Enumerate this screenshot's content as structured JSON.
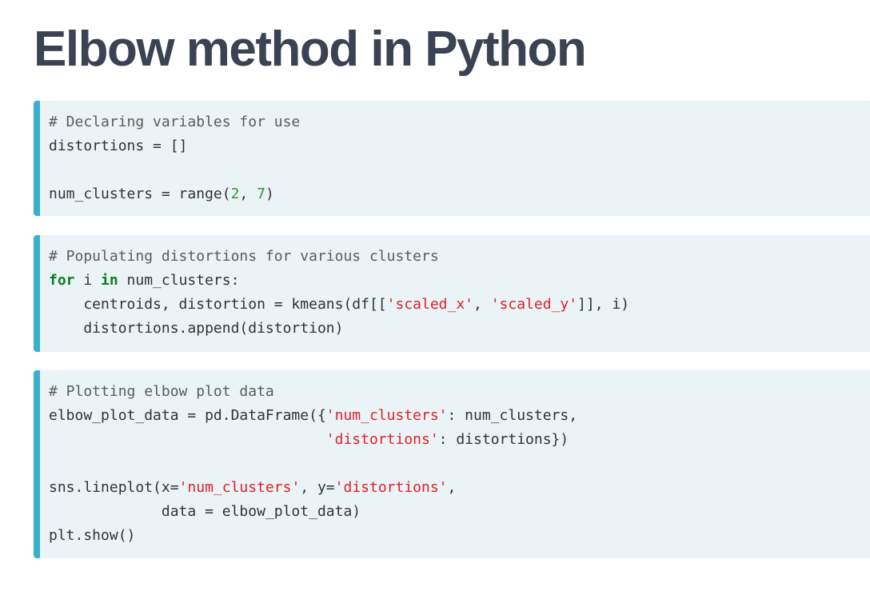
{
  "title": "Elbow method in Python",
  "code_blocks": [
    {
      "lines": [
        [
          {
            "t": "# Declaring variables for use",
            "k": "comment"
          }
        ],
        [
          {
            "t": "distortions = []",
            "k": "plain"
          }
        ],
        [],
        [
          {
            "t": "num_clusters = range(",
            "k": "plain"
          },
          {
            "t": "2",
            "k": "num"
          },
          {
            "t": ", ",
            "k": "plain"
          },
          {
            "t": "7",
            "k": "num"
          },
          {
            "t": ")",
            "k": "plain"
          }
        ]
      ]
    },
    {
      "lines": [
        [
          {
            "t": "# Populating distortions for various clusters",
            "k": "comment"
          }
        ],
        [
          {
            "t": "for",
            "k": "kw"
          },
          {
            "t": " i ",
            "k": "plain"
          },
          {
            "t": "in",
            "k": "kw"
          },
          {
            "t": " num_clusters:",
            "k": "plain"
          }
        ],
        [
          {
            "t": "    centroids, distortion = kmeans(df[[",
            "k": "plain"
          },
          {
            "t": "'scaled_x'",
            "k": "str"
          },
          {
            "t": ", ",
            "k": "plain"
          },
          {
            "t": "'scaled_y'",
            "k": "str"
          },
          {
            "t": "]], i)",
            "k": "plain"
          }
        ],
        [
          {
            "t": "    distortions.append(distortion)",
            "k": "plain"
          }
        ]
      ]
    },
    {
      "lines": [
        [
          {
            "t": "# Plotting elbow plot data",
            "k": "comment"
          }
        ],
        [
          {
            "t": "elbow_plot_data = pd.DataFrame({",
            "k": "plain"
          },
          {
            "t": "'num_clusters'",
            "k": "str"
          },
          {
            "t": ": num_clusters,",
            "k": "plain"
          }
        ],
        [
          {
            "t": "                                ",
            "k": "plain"
          },
          {
            "t": "'distortions'",
            "k": "str"
          },
          {
            "t": ": distortions})",
            "k": "plain"
          }
        ],
        [],
        [
          {
            "t": "sns.lineplot(x=",
            "k": "plain"
          },
          {
            "t": "'num_clusters'",
            "k": "str"
          },
          {
            "t": ", y=",
            "k": "plain"
          },
          {
            "t": "'distortions'",
            "k": "str"
          },
          {
            "t": ",",
            "k": "plain"
          }
        ],
        [
          {
            "t": "             data = elbow_plot_data)",
            "k": "plain"
          }
        ],
        [
          {
            "t": "plt.show()",
            "k": "plain"
          }
        ]
      ]
    }
  ]
}
